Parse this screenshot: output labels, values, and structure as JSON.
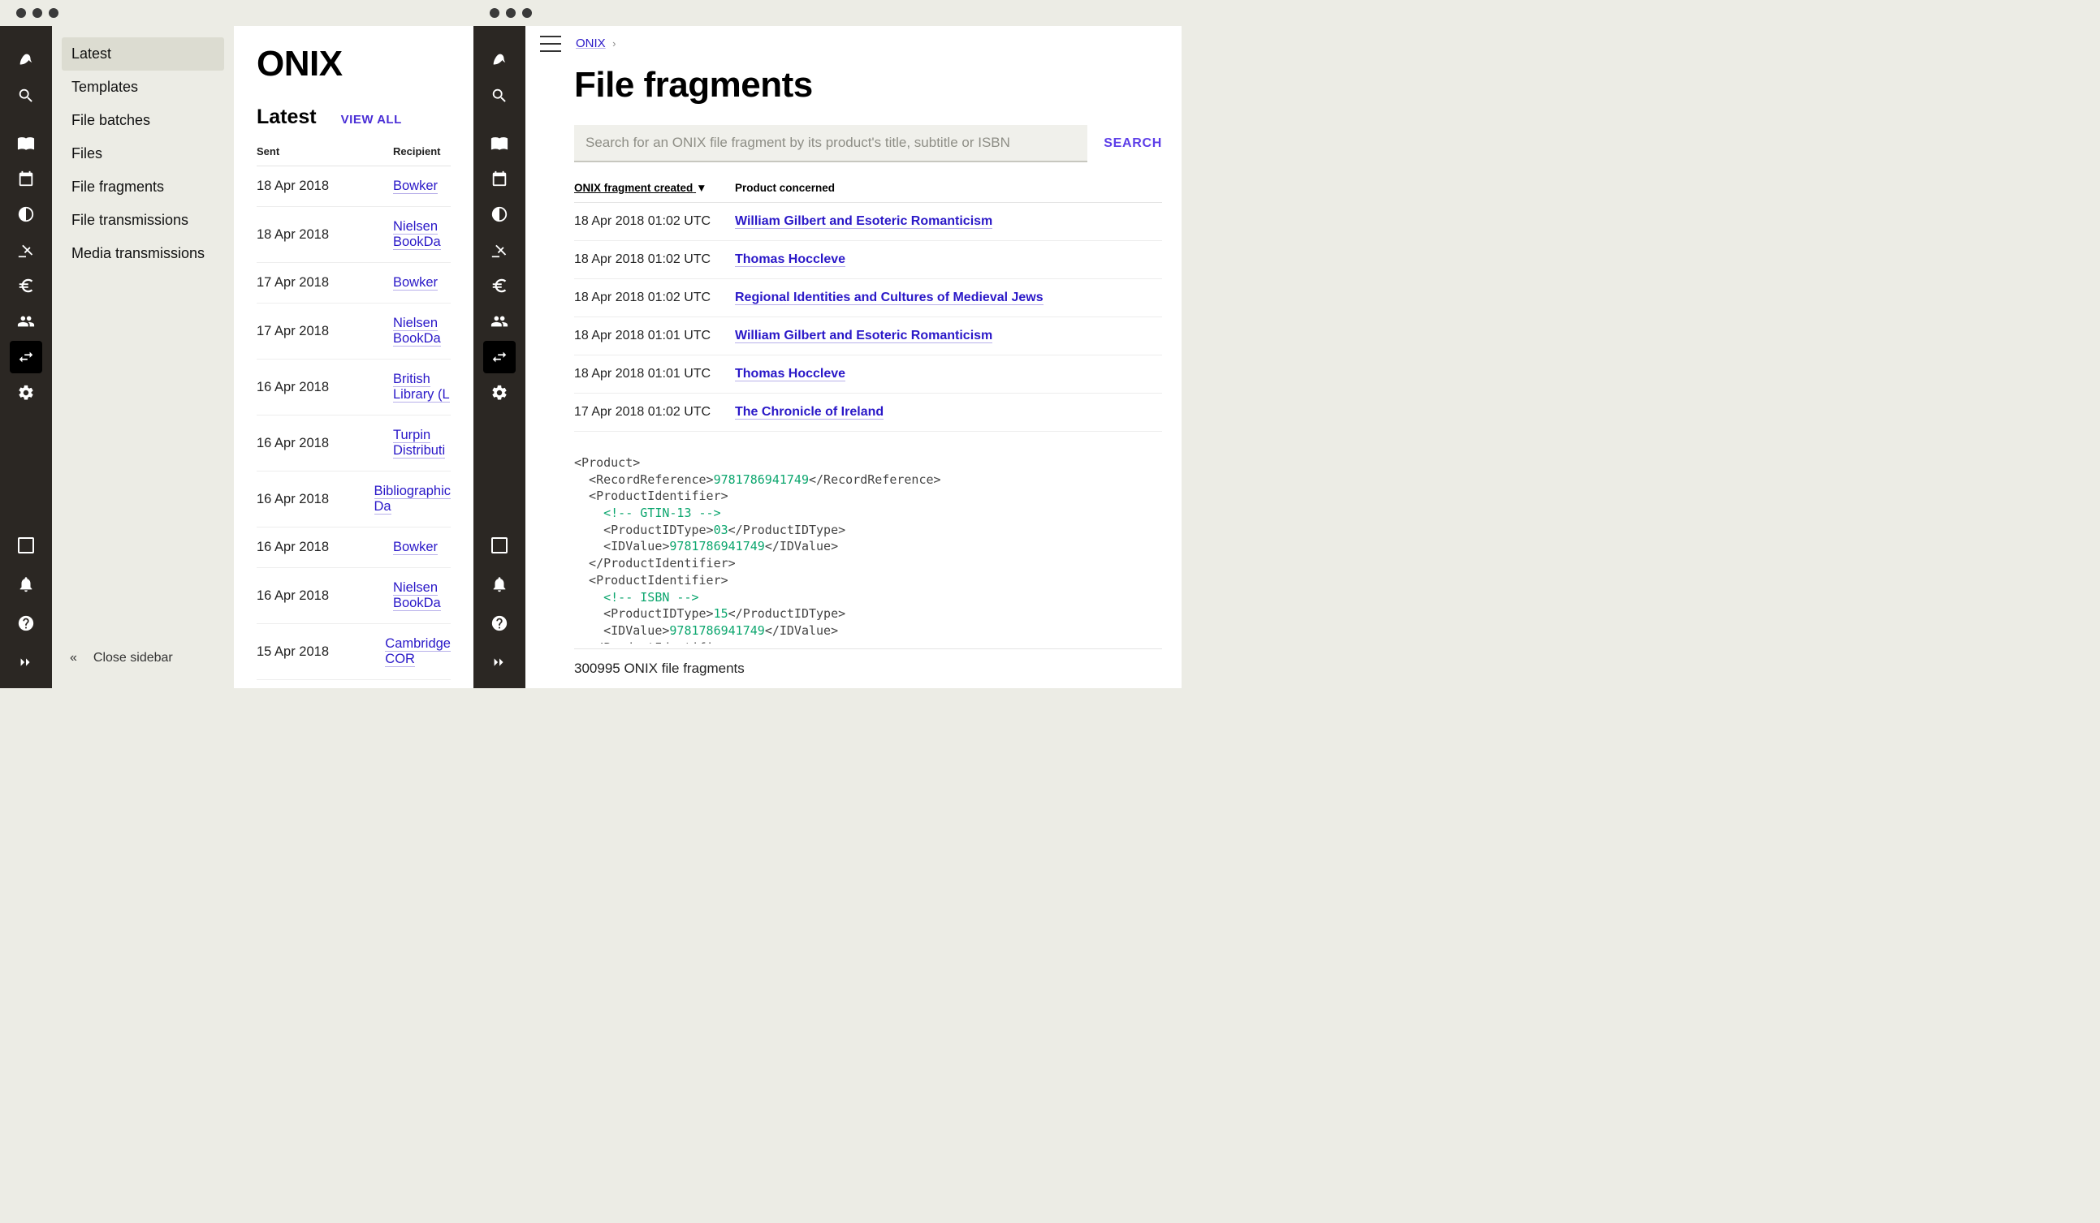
{
  "left_window": {
    "sub_sidebar": {
      "items": [
        "Latest",
        "Templates",
        "File batches",
        "Files",
        "File fragments",
        "File transmissions",
        "Media transmissions"
      ],
      "active_index": 0,
      "close_label": "Close sidebar"
    },
    "main": {
      "title": "ONIX",
      "section_title": "Latest",
      "view_all": "VIEW ALL",
      "columns": {
        "sent": "Sent",
        "recipient": "Recipient"
      },
      "rows": [
        {
          "sent": "18 Apr 2018",
          "recipient": "Bowker"
        },
        {
          "sent": "18 Apr 2018",
          "recipient": "Nielsen BookDa"
        },
        {
          "sent": "17 Apr 2018",
          "recipient": "Bowker"
        },
        {
          "sent": "17 Apr 2018",
          "recipient": "Nielsen BookDa"
        },
        {
          "sent": "16 Apr 2018",
          "recipient": "British Library (L"
        },
        {
          "sent": "16 Apr 2018",
          "recipient": "Turpin Distributi"
        },
        {
          "sent": "16 Apr 2018",
          "recipient": "Bibliographic Da"
        },
        {
          "sent": "16 Apr 2018",
          "recipient": "Bowker"
        },
        {
          "sent": "16 Apr 2018",
          "recipient": "Nielsen BookDa"
        },
        {
          "sent": "15 Apr 2018",
          "recipient": "Cambridge COR"
        }
      ]
    }
  },
  "right_window": {
    "breadcrumb": {
      "root": "ONIX"
    },
    "page_title": "File fragments",
    "search": {
      "placeholder": "Search for an ONIX file fragment by its product's title, subtitle or ISBN",
      "button": "SEARCH"
    },
    "columns": {
      "created": "ONIX fragment created",
      "sort_indicator": "▼",
      "product": "Product concerned"
    },
    "rows": [
      {
        "date": "18 Apr 2018 01:02 UTC",
        "product": "William Gilbert and Esoteric Romanticism"
      },
      {
        "date": "18 Apr 2018 01:02 UTC",
        "product": "Thomas Hoccleve"
      },
      {
        "date": "18 Apr 2018 01:02 UTC",
        "product": "Regional Identities and Cultures of Medieval Jews"
      },
      {
        "date": "18 Apr 2018 01:01 UTC",
        "product": "William Gilbert and Esoteric Romanticism"
      },
      {
        "date": "18 Apr 2018 01:01 UTC",
        "product": "Thomas Hoccleve"
      },
      {
        "date": "17 Apr 2018 01:02 UTC",
        "product": "The Chronicle of Ireland"
      }
    ],
    "xml": {
      "record_reference": "9781786941749",
      "gtin_comment": "<!-- GTIN-13 -->",
      "gtin_type": "03",
      "gtin_value": "9781786941749",
      "isbn_comment": "<!-- ISBN -->",
      "isbn_type": "15",
      "isbn_value": "9781786941749"
    },
    "footer_count": "300995 ONIX file fragments"
  },
  "rail_icons": [
    "bird-icon",
    "search-icon",
    "book-icon",
    "calendar-icon",
    "contrast-icon",
    "auction-icon",
    "euro-icon",
    "people-icon",
    "swap-icon",
    "gear-icon"
  ],
  "rail_bottom_icons": [
    "square-icon",
    "bell-icon",
    "help-icon",
    "expand-icon"
  ]
}
